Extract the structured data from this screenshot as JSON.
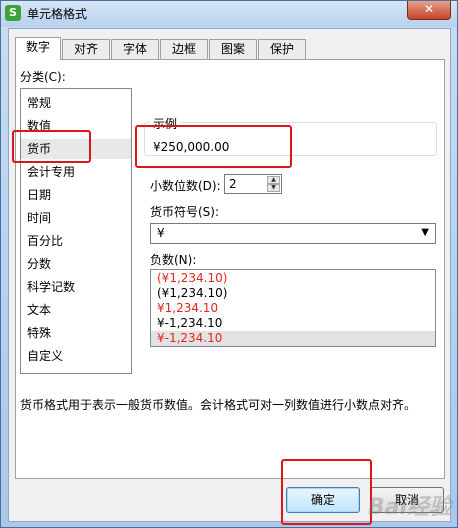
{
  "window": {
    "title": "单元格格式",
    "app_icon": "S",
    "close_glyph": "✕"
  },
  "tabs": [
    {
      "label": "数字"
    },
    {
      "label": "对齐"
    },
    {
      "label": "字体"
    },
    {
      "label": "边框"
    },
    {
      "label": "图案"
    },
    {
      "label": "保护"
    }
  ],
  "category": {
    "label": "分类(C):",
    "items": [
      "常规",
      "数值",
      "货币",
      "会计专用",
      "日期",
      "时间",
      "百分比",
      "分数",
      "科学记数",
      "文本",
      "特殊",
      "自定义"
    ],
    "selected": "货币"
  },
  "sample": {
    "label": "示例",
    "value": "¥250,000.00"
  },
  "decimals": {
    "label": "小数位数(D):",
    "value": "2"
  },
  "currency": {
    "label": "货币符号(S):",
    "value": "¥"
  },
  "negative": {
    "label": "负数(N):",
    "items": [
      "(¥1,234.10)",
      "(¥1,234.10)",
      "¥1,234.10",
      "¥-1,234.10",
      "¥-1,234.10"
    ],
    "selected_index": 4
  },
  "description": "货币格式用于表示一般货币数值。会计格式可对一列数值进行小数点对齐。",
  "buttons": {
    "ok": "确定",
    "cancel": "取消"
  },
  "watermark": "Bai经验",
  "colors": {
    "red": "#e0281a",
    "highlight": "#e0141e"
  }
}
